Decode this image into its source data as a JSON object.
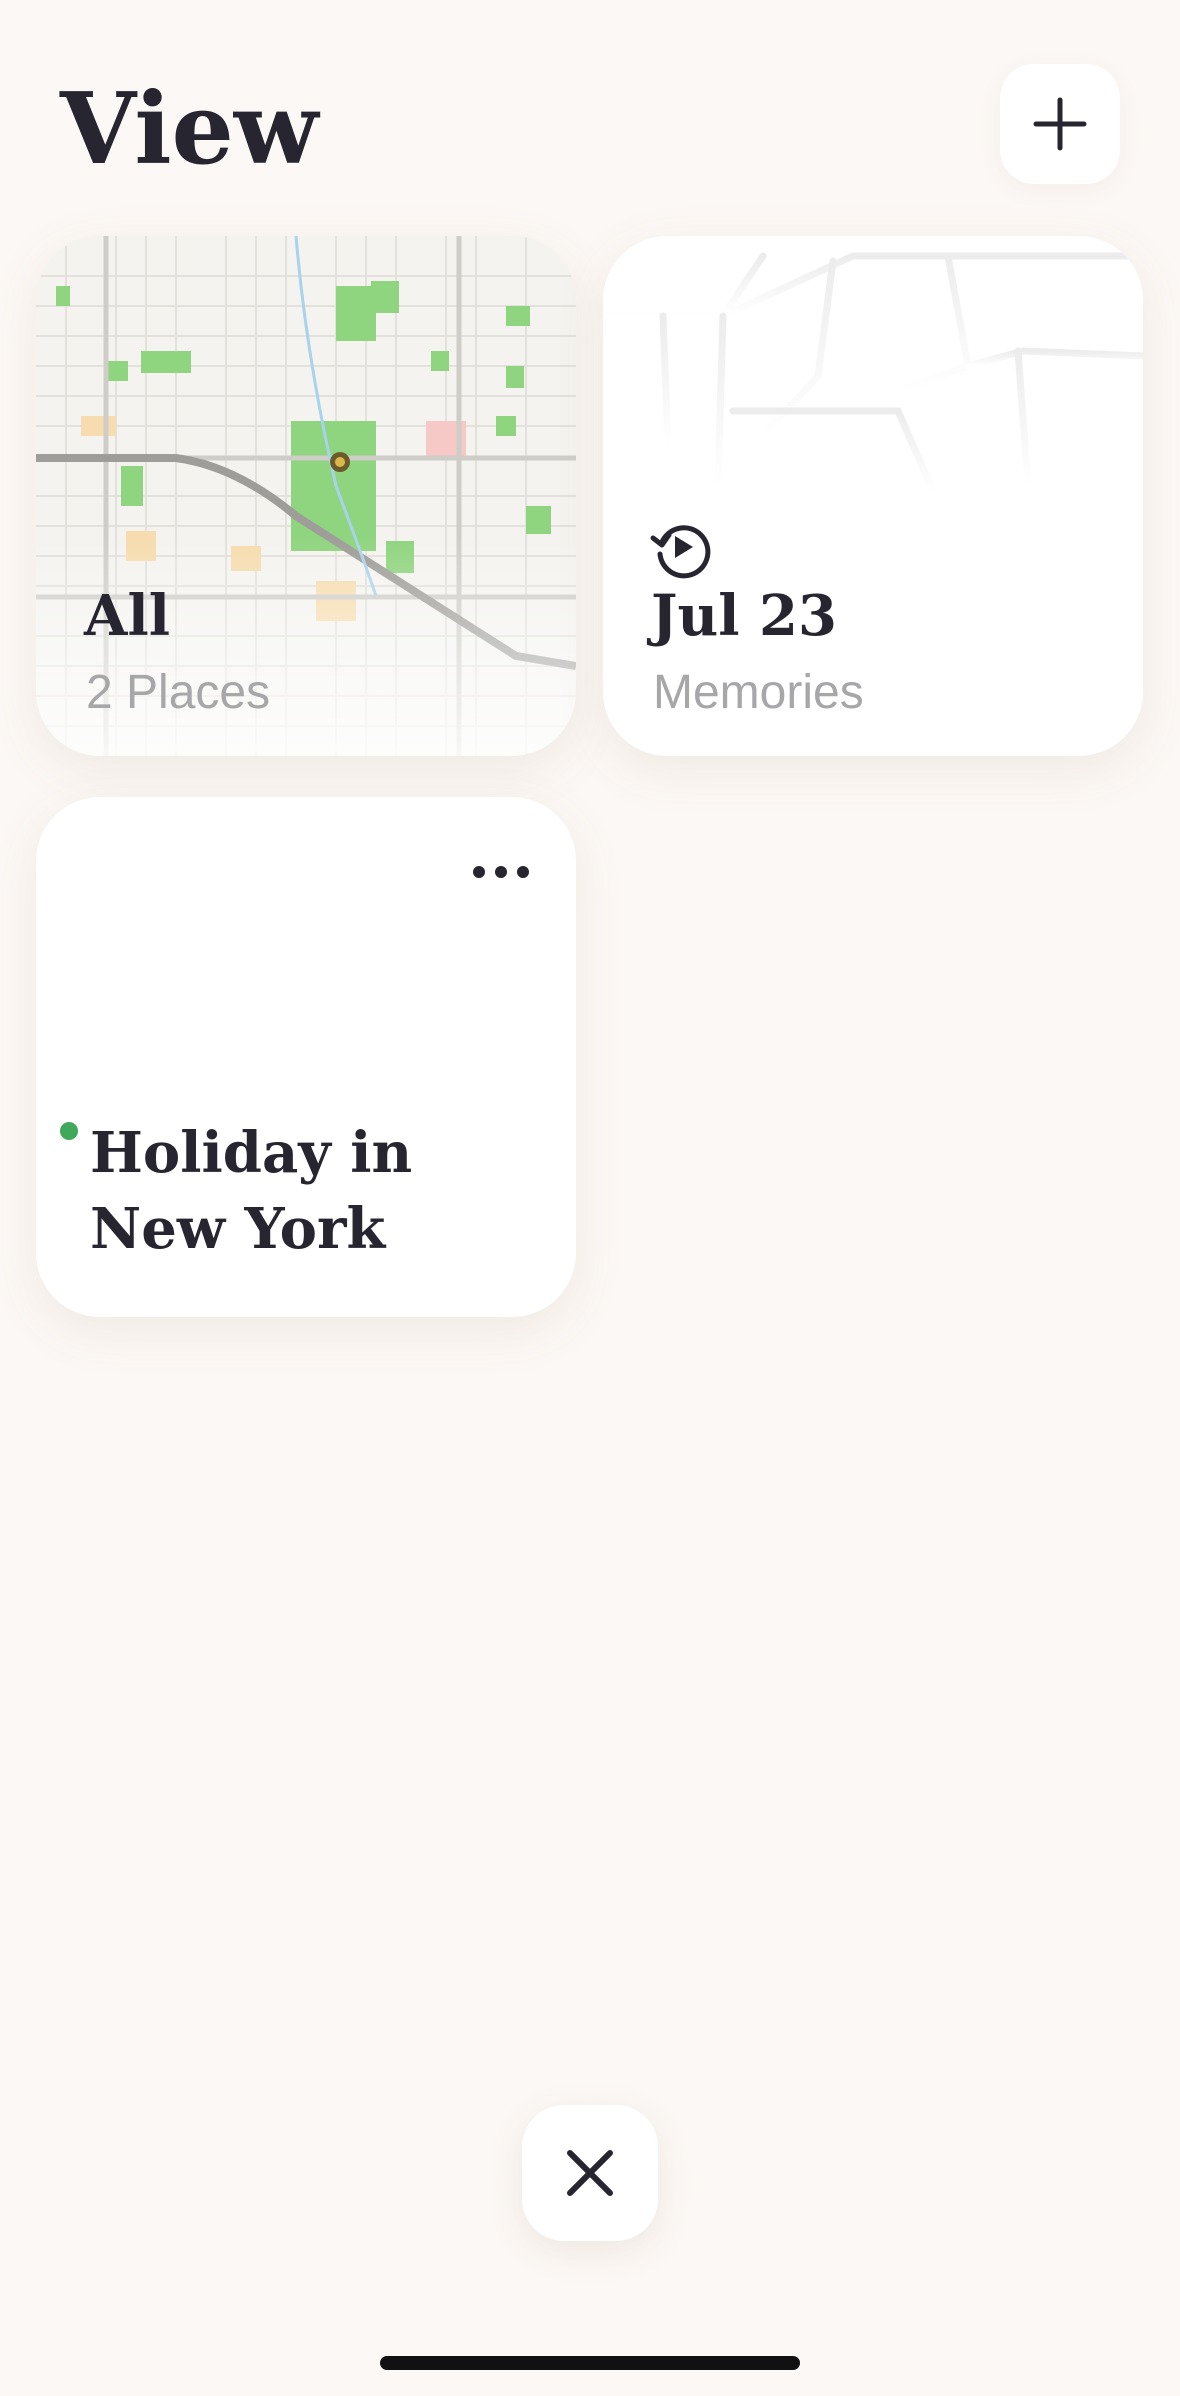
{
  "header": {
    "title": "View",
    "add_icon": "plus-icon"
  },
  "cards": {
    "all": {
      "title": "All",
      "subtitle": "2 Places",
      "background": "map-thumbnail"
    },
    "memories": {
      "icon": "replay-icon",
      "title": "Jul 23",
      "subtitle": "Memories"
    },
    "holiday": {
      "title": "Holiday in New York",
      "status_color": "#3fa85a",
      "menu_icon": "more-dots-icon"
    }
  },
  "footer": {
    "close_icon": "close-icon"
  },
  "colors": {
    "background": "#fcf8f5",
    "text": "#262530",
    "muted": "#a7a6a9",
    "card": "#ffffff",
    "accent_green": "#3fa85a"
  }
}
